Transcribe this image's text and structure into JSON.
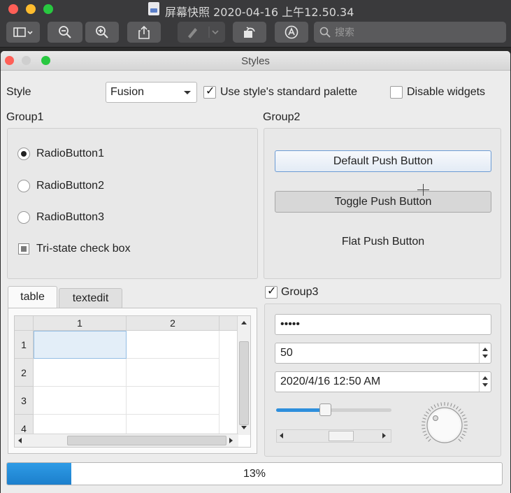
{
  "outer_window": {
    "title": "屏幕快照 2020-04-16 上午12.50.34",
    "search_placeholder": "搜索",
    "toolbar_icons": [
      "sidebar-icon",
      "zoom-out-icon",
      "zoom-in-icon",
      "share-icon",
      "markup-pen-icon",
      "rotate-icon",
      "annotate-icon",
      "search-icon"
    ]
  },
  "window": {
    "title": "Styles"
  },
  "top_row": {
    "style_label": "Style",
    "style_value": "Fusion",
    "use_palette_label": "Use style's standard palette",
    "use_palette_checked": true,
    "disable_widgets_label": "Disable widgets",
    "disable_widgets_checked": false
  },
  "group1": {
    "title": "Group1",
    "radios": [
      {
        "label": "RadioButton1",
        "checked": true
      },
      {
        "label": "RadioButton2",
        "checked": false
      },
      {
        "label": "RadioButton3",
        "checked": false
      }
    ],
    "tristate_label": "Tri-state check box"
  },
  "group2": {
    "title": "Group2",
    "default_button": "Default Push Button",
    "toggle_button": "Toggle Push Button",
    "flat_button": "Flat Push Button"
  },
  "tabs": {
    "items": [
      "table",
      "textedit"
    ],
    "active": "table"
  },
  "table": {
    "columns": [
      "1",
      "2"
    ],
    "rows": [
      "1",
      "2",
      "3",
      "4"
    ]
  },
  "group3": {
    "title": "Group3",
    "checked": true,
    "password_value": "•••••",
    "spin_value": "50",
    "datetime_value": "2020/4/16 12:50 AM",
    "slider_value_fraction": 0.42
  },
  "progress": {
    "value_fraction": 0.13,
    "text": "13%"
  },
  "colors": {
    "accent": "#2e8fdc",
    "default_button_border": "#6b9bd4"
  }
}
